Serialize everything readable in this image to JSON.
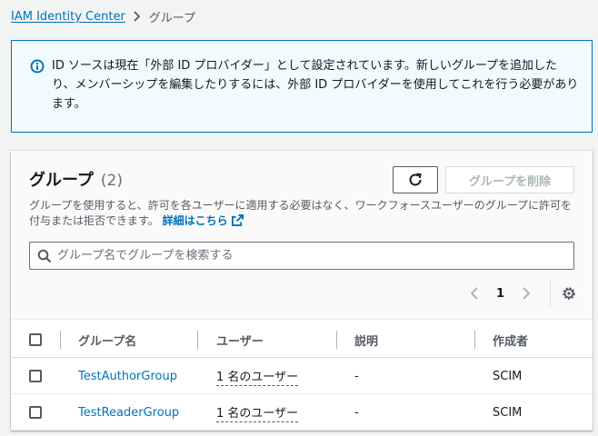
{
  "breadcrumb": {
    "parent": "IAM Identity Center",
    "current": "グループ"
  },
  "alert": {
    "icon": "info-icon",
    "text": "ID ソースは現在「外部 ID プロバイダー」として設定されています。新しいグループを追加したり、メンバーシップを編集したりするには、外部 ID プロバイダーを使用してこれを行う必要があります。"
  },
  "panel": {
    "title": "グループ",
    "count": "(2)",
    "refresh_icon": "refresh-icon",
    "delete_label": "グループを削除",
    "description": "グループを使用すると、許可を各ユーザーに適用する必要はなく、ワークフォースユーザーのグループに許可を付与または拒否できます。",
    "learn_more": "詳細はこちら",
    "search_placeholder": "グループ名でグループを検索する",
    "page": "1"
  },
  "table": {
    "columns": [
      "グループ名",
      "ユーザー",
      "説明",
      "作成者"
    ],
    "rows": [
      {
        "name": "TestAuthorGroup",
        "users": "1 名のユーザー",
        "description": "-",
        "creator": "SCIM"
      },
      {
        "name": "TestReaderGroup",
        "users": "1 名のユーザー",
        "description": "-",
        "creator": "SCIM"
      }
    ]
  },
  "colors": {
    "link": "#0073bb",
    "info_border": "#0073bb",
    "info_bg": "#f1faff"
  }
}
